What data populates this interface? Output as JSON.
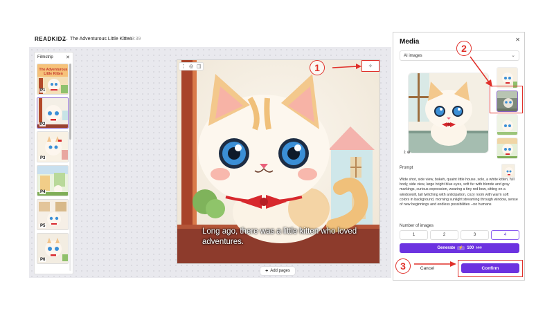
{
  "header": {
    "logo": "READKIDZ",
    "back_icon": "arrow-left-icon",
    "title": "The Adventurous Little Kitten",
    "time": "15:49:39"
  },
  "filmstrip": {
    "title": "Filmstrip",
    "close_icon": "close-icon",
    "pages": [
      {
        "label": "P1"
      },
      {
        "label": "P2",
        "selected": true
      },
      {
        "label": "P3"
      },
      {
        "label": "P4"
      },
      {
        "label": "P5"
      },
      {
        "label": "P6"
      }
    ]
  },
  "canvas": {
    "caption": "Long ago, there was a little kitten who loved adventures.",
    "add_pages_label": "Add pages",
    "toolbar_icons": [
      "more-icon",
      "ai-edit-icon",
      "layout-icon"
    ],
    "ai_button_icon": "sparkle-icon"
  },
  "annotations": {
    "step1": "1",
    "step2": "2",
    "step3": "3",
    "color": "#e0302a"
  },
  "media": {
    "title": "Media",
    "close_icon": "close-icon",
    "source_select": "AI images",
    "prompt_label": "Prompt",
    "prompt_text": "Wide shot, side view, bokeh, quaint little house, solo, a white kitten, full body, side view, large bright blue eyes, soft fur with blonde and gray markings, curious expression, wearing a tiny red bow, sitting on a windowsill, tail twitching with anticipation, cozy room with warm soft colors in background, morning sunlight streaming through window, sense of new beginnings and endless possibilities --no humans",
    "number_label": "Number of images",
    "number_options": [
      "1",
      "2",
      "3",
      "4"
    ],
    "selected_number": "4",
    "generate_label": "Generate",
    "credit_new": "100",
    "credit_old": "150",
    "cancel_label": "Cancel",
    "confirm_label": "Confirm",
    "accent": "#6c32e0"
  }
}
